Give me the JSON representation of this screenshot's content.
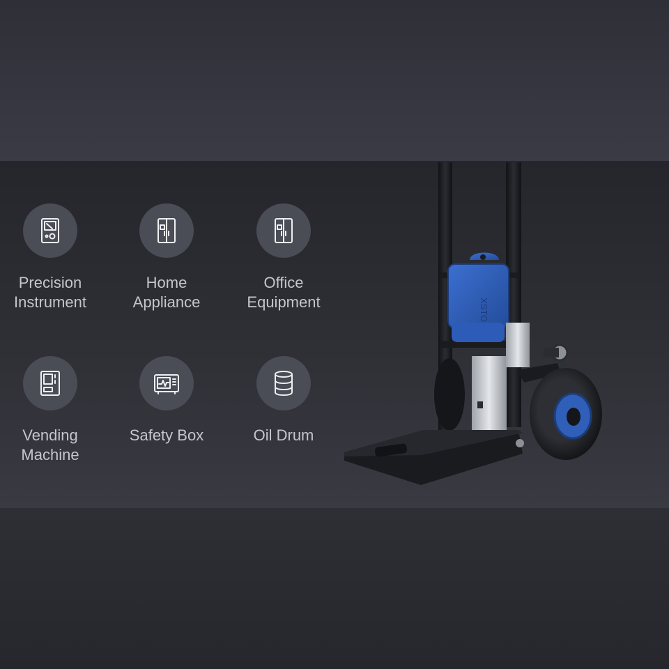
{
  "applications": [
    {
      "label": "Precision\nInstrument",
      "icon": "precision-instrument-icon"
    },
    {
      "label": "Home\nAppliance",
      "icon": "refrigerator-icon"
    },
    {
      "label": "Office\nEquipment",
      "icon": "cabinet-icon"
    },
    {
      "label": "Vending\nMachine",
      "icon": "vending-machine-icon"
    },
    {
      "label": "Safety Box",
      "icon": "safety-box-icon"
    },
    {
      "label": "Oil Drum",
      "icon": "oil-drum-icon"
    }
  ],
  "product": {
    "accent": "#2f5fb8",
    "frame": "#1c1d21"
  }
}
